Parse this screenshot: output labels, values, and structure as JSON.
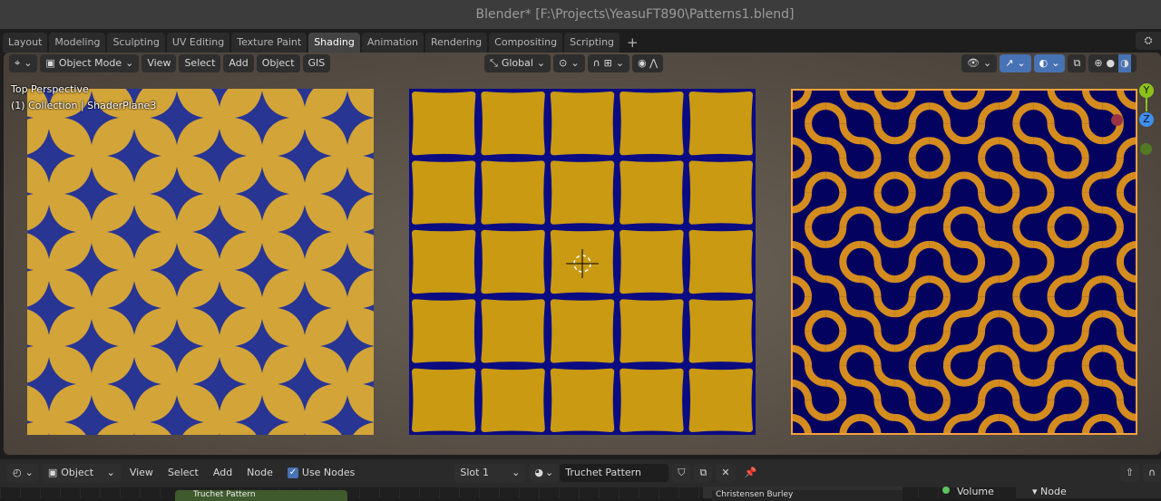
{
  "window": {
    "title": "Blender* [F:\\Projects\\YeasuFT890\\Patterns1.blend]"
  },
  "workspaces": {
    "tabs": [
      "Layout",
      "Modeling",
      "Sculpting",
      "UV Editing",
      "Texture Paint",
      "Shading",
      "Animation",
      "Rendering",
      "Compositing",
      "Scripting"
    ],
    "active": "Shading",
    "add": "+"
  },
  "viewport": {
    "mode": "Object Mode",
    "menus": [
      "View",
      "Select",
      "Add",
      "Object",
      "GIS"
    ],
    "orientation": "Global",
    "overlay_view": "Top Perspective",
    "overlay_object": "(1) Collection | ShaderPlane3",
    "gizmo": {
      "y": "Y",
      "z": "Z"
    }
  },
  "colors": {
    "gold": "#d3a438",
    "blue": "#283593",
    "tile_gold": "#c99a12",
    "navy": "#0b0b82",
    "truchet_bg": "#03035f",
    "truchet_line": "#d58c1e",
    "selected_outline": "#f5a13b",
    "accent": "#4772b3"
  },
  "node_editor": {
    "object_type": "Object",
    "menus": [
      "View",
      "Select",
      "Add",
      "Node"
    ],
    "use_nodes": "Use Nodes",
    "use_nodes_checked": true,
    "slot": "Slot 1",
    "material": "Truchet Pattern",
    "node_title": "Truchet Pattern",
    "dropdown": "Christensen Burley",
    "socket": "Volume",
    "panel": "Node"
  }
}
